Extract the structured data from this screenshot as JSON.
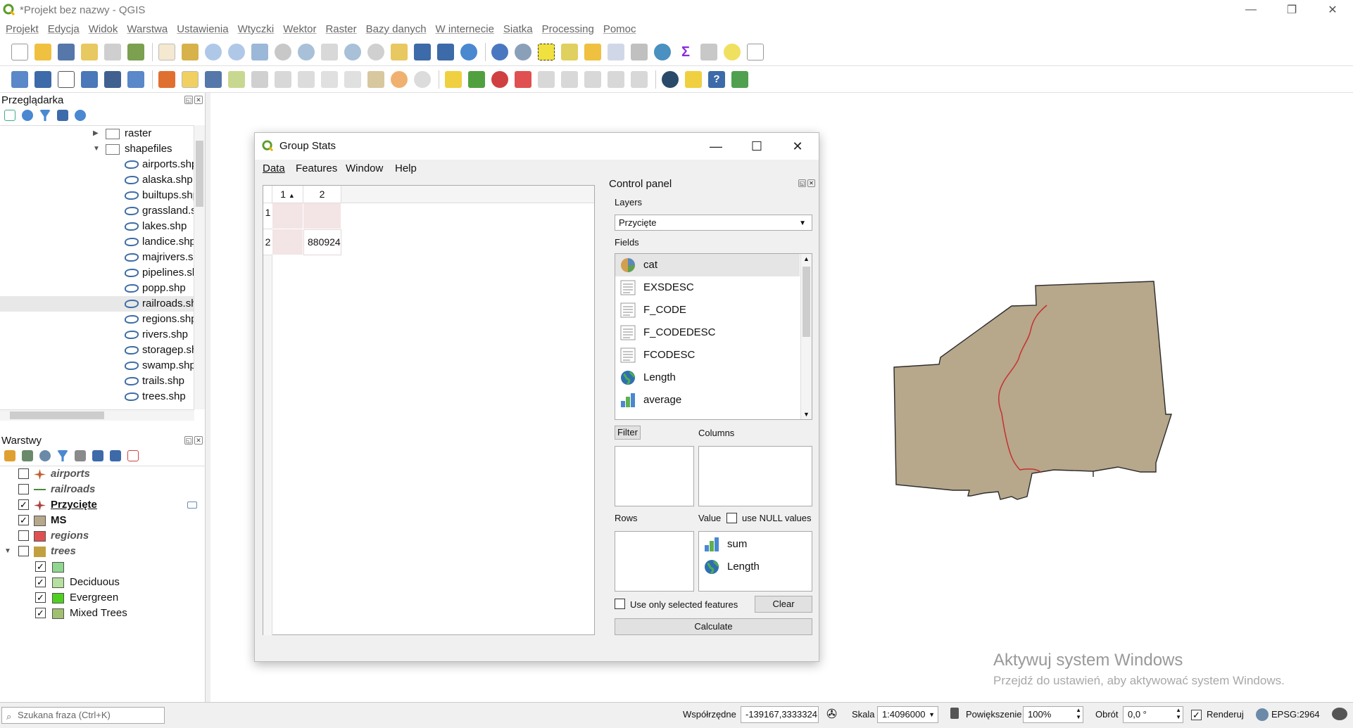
{
  "app": {
    "title": "*Projekt bez nazwy - QGIS",
    "window_controls": [
      "—",
      "❐",
      "✕"
    ]
  },
  "menu": [
    "Projekt",
    "Edycja",
    "Widok",
    "Warstwa",
    "Ustawienia",
    "Wtyczki",
    "Wektor",
    "Raster",
    "Bazy danych",
    "W internecie",
    "Siatka",
    "Processing",
    "Pomoc"
  ],
  "browser": {
    "title": "Przeglądarka",
    "items": [
      {
        "label": "raster",
        "type": "folder",
        "expanded": false
      },
      {
        "label": "shapefiles",
        "type": "folder",
        "expanded": true
      },
      {
        "label": "airports.shp",
        "type": "shp"
      },
      {
        "label": "alaska.shp",
        "type": "shp"
      },
      {
        "label": "builtups.shp",
        "type": "shp"
      },
      {
        "label": "grassland.shp",
        "type": "shp"
      },
      {
        "label": "lakes.shp",
        "type": "shp"
      },
      {
        "label": "landice.shp",
        "type": "shp"
      },
      {
        "label": "majrivers.shp",
        "type": "shp"
      },
      {
        "label": "pipelines.shp",
        "type": "shp"
      },
      {
        "label": "popp.shp",
        "type": "shp"
      },
      {
        "label": "railroads.shp",
        "type": "shp",
        "selected": true
      },
      {
        "label": "regions.shp",
        "type": "shp"
      },
      {
        "label": "rivers.shp",
        "type": "shp"
      },
      {
        "label": "storagep.shp",
        "type": "shp"
      },
      {
        "label": "swamp.shp",
        "type": "shp"
      },
      {
        "label": "trails.shp",
        "type": "shp"
      },
      {
        "label": "trees.shp",
        "type": "shp"
      }
    ]
  },
  "layers_panel": {
    "title": "Warstwy",
    "layers": [
      {
        "label": "airports",
        "checked": false,
        "style": "italic",
        "symbol_color": "#c06030"
      },
      {
        "label": "railroads",
        "checked": false,
        "style": "italic",
        "symbol_color": "#4a8a3a"
      },
      {
        "label": "Przycięte",
        "checked": true,
        "style": "bold-underline",
        "symbol_color": "#b04040"
      },
      {
        "label": "MS",
        "checked": true,
        "style": "bold",
        "symbol_color": "#b7a78b"
      },
      {
        "label": "regions",
        "checked": false,
        "style": "italic",
        "symbol_color": "#e05050"
      },
      {
        "label": "trees",
        "checked": false,
        "style": "italic",
        "symbol_color": "#c0a040"
      }
    ],
    "tree_classes": [
      {
        "label": "",
        "checked": true,
        "color": "#8fd68f"
      },
      {
        "label": "Deciduous",
        "checked": true,
        "color": "#b5e0a0"
      },
      {
        "label": "Evergreen",
        "checked": true,
        "color": "#4fd020"
      },
      {
        "label": "Mixed Trees",
        "checked": true,
        "color": "#a0c070"
      }
    ]
  },
  "status": {
    "search_placeholder": "Szukana fraza (Ctrl+K)",
    "coord_label": "Współrzędne",
    "coord_value": "-139167,3333324",
    "scale_label": "Skala",
    "scale_value": "1:4096000",
    "zoom_label": "Powiększenie",
    "zoom_value": "100%",
    "rotation_label": "Obrót",
    "rotation_value": "0,0 °",
    "render_label": "Renderuj",
    "crs": "EPSG:2964"
  },
  "watermark": {
    "line1": "Aktywuj system Windows",
    "line2": "Przejdź do ustawień, aby aktywować system Windows."
  },
  "dialog": {
    "title": "Group Stats",
    "menu": [
      "Data",
      "Features",
      "Window",
      "Help"
    ],
    "table": {
      "columns": [
        "1",
        "2"
      ],
      "rows": [
        "1",
        "2"
      ],
      "value": "880924"
    },
    "control_panel": {
      "title": "Control panel",
      "layers_label": "Layers",
      "layer_selected": "Przycięte",
      "fields_label": "Fields",
      "fields": [
        {
          "label": "cat",
          "icon": "pie-icon"
        },
        {
          "label": "EXSDESC",
          "icon": "text-icon"
        },
        {
          "label": "F_CODE",
          "icon": "text-icon"
        },
        {
          "label": "F_CODEDESC",
          "icon": "text-icon"
        },
        {
          "label": "FCODESC",
          "icon": "text-icon"
        },
        {
          "label": "Length",
          "icon": "globe-icon"
        },
        {
          "label": "average",
          "icon": "bar-chart-icon"
        }
      ],
      "filter_label": "Filter",
      "columns_label": "Columns",
      "rows_label": "Rows",
      "value_label": "Value",
      "use_null_label": "use NULL values",
      "value_items": [
        {
          "label": "sum",
          "icon": "bar-chart-icon"
        },
        {
          "label": "Length",
          "icon": "globe-icon"
        }
      ],
      "only_selected_label": "Use only selected features",
      "clear_label": "Clear",
      "calculate_label": "Calculate"
    }
  }
}
